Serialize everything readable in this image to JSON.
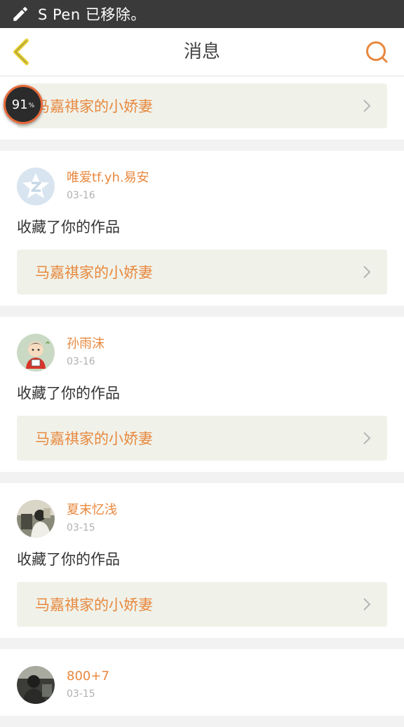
{
  "status_bar": {
    "text": "S Pen 已移除。"
  },
  "header": {
    "title": "消息"
  },
  "colors": {
    "accent": "#e8883e",
    "work_bg": "#f0f2ea",
    "status_bar": "#3a3a3a"
  },
  "pinned_work": {
    "label": "马嘉祺家的小娇妻"
  },
  "badge": {
    "value": "91",
    "unit": "%"
  },
  "messages": [
    {
      "name": "唯爱tf.yh.易安",
      "date": "03-16",
      "action": "收藏了你的作品",
      "work": "马嘉祺家的小娇妻",
      "avatar": "qq-default-avatar"
    },
    {
      "name": "孙雨沫",
      "date": "03-16",
      "action": "收藏了你的作品",
      "work": "马嘉祺家的小娇妻",
      "avatar": "cartoon-avatar"
    },
    {
      "name": "夏末忆浅",
      "date": "03-15",
      "action": "收藏了你的作品",
      "work": "马嘉祺家的小娇妻",
      "avatar": "photo-avatar"
    },
    {
      "name": "800+7",
      "date": "03-15",
      "avatar": "photo-avatar"
    }
  ]
}
